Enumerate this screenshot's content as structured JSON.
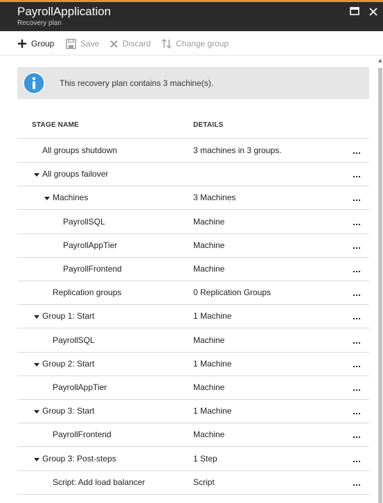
{
  "window": {
    "title": "PayrollApplication",
    "subtitle": "Recovery plan",
    "accent_color": "#e8912c",
    "header_color": "#2b2b2b"
  },
  "toolbar": {
    "group_label": "Group",
    "save_label": "Save",
    "discard_label": "Discard",
    "change_group_label": "Change group"
  },
  "info": {
    "message": "This recovery plan contains 3 machine(s).",
    "icon_color": "#3a96dd"
  },
  "table": {
    "col_stage": "STAGE NAME",
    "col_details": "DETAILS",
    "rows": [
      {
        "name": "All groups shutdown",
        "details": "3 machines in 3 groups.",
        "depth": 1,
        "expand": false
      },
      {
        "name": "All groups failover",
        "details": "",
        "depth": 1,
        "expand": true
      },
      {
        "name": "Machines",
        "details": "3 Machines",
        "depth": 2,
        "expand": true
      },
      {
        "name": "PayrollSQL",
        "details": "Machine",
        "depth": 3,
        "expand": false
      },
      {
        "name": "PayrollAppTier",
        "details": "Machine",
        "depth": 3,
        "expand": false
      },
      {
        "name": "PayrollFrontend",
        "details": "Machine",
        "depth": 3,
        "expand": false
      },
      {
        "name": "Replication groups",
        "details": "0 Replication Groups",
        "depth": 2,
        "expand": false
      },
      {
        "name": "Group 1: Start",
        "details": "1 Machine",
        "depth": 1,
        "expand": true
      },
      {
        "name": "PayrollSQL",
        "details": "Machine",
        "depth": 2,
        "expand": false
      },
      {
        "name": "Group 2: Start",
        "details": "1 Machine",
        "depth": 1,
        "expand": true
      },
      {
        "name": "PayrollAppTier",
        "details": "Machine",
        "depth": 2,
        "expand": false
      },
      {
        "name": "Group 3: Start",
        "details": "1 Machine",
        "depth": 1,
        "expand": true
      },
      {
        "name": "PayrollFrontend",
        "details": "Machine",
        "depth": 2,
        "expand": false
      },
      {
        "name": "Group 3: Post-steps",
        "details": "1 Step",
        "depth": 1,
        "expand": true
      },
      {
        "name": "Script: Add load balancer",
        "details": "Script",
        "depth": 2,
        "expand": false
      }
    ]
  }
}
